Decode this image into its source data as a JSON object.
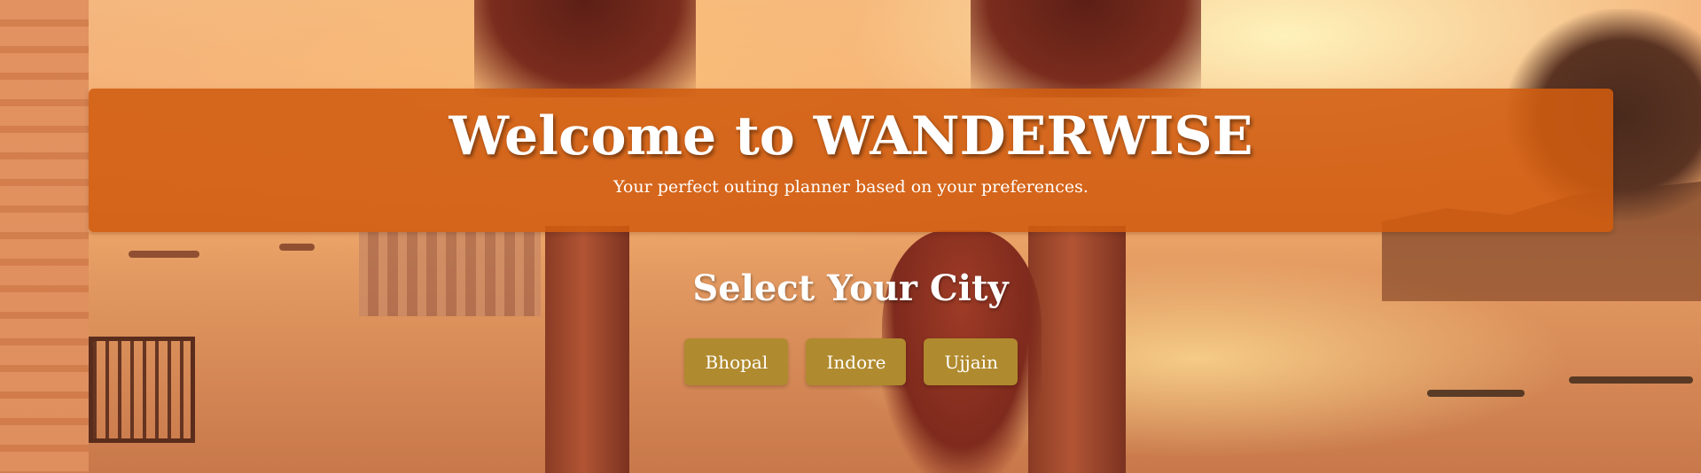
{
  "hero": {
    "title": "Welcome to WANDERWISE",
    "subtitle": "Your perfect outing planner based on your preferences."
  },
  "city_selector": {
    "heading": "Select Your City",
    "cities": [
      {
        "label": "Bhopal"
      },
      {
        "label": "Indore"
      },
      {
        "label": "Ujjain"
      }
    ]
  },
  "colors": {
    "hero_background": "#d05c10",
    "button_background": "#b08a2e",
    "text": "#ffffff"
  }
}
